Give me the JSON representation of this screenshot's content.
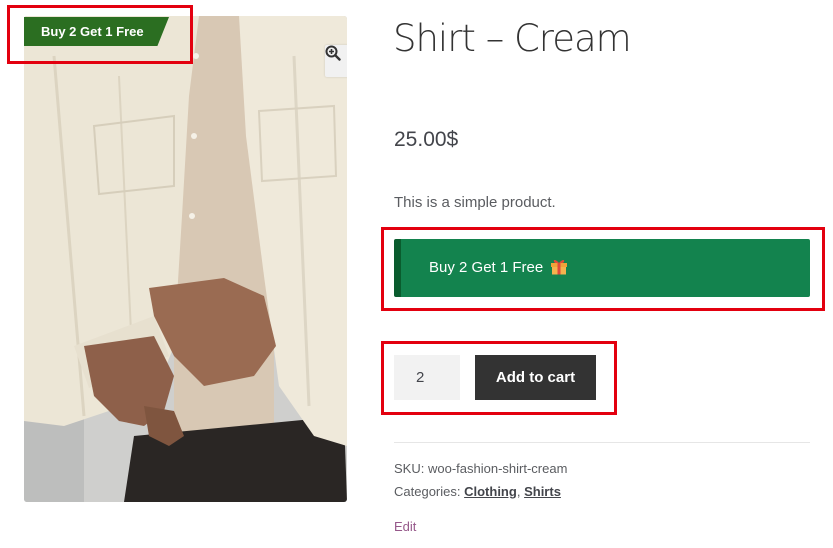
{
  "product": {
    "title": "Shirt – Cream",
    "price": "25.00$",
    "short_description": "This is a simple product.",
    "image_alt": "Man buttoning a cream corduroy shirt"
  },
  "badge": {
    "label": "Buy 2 Get 1 Free",
    "color": "#2b6e21"
  },
  "offer": {
    "label": "Buy 2 Get 1 Free",
    "icon": "gift-icon",
    "color": "#13834e"
  },
  "cart": {
    "quantity": "2",
    "add_label": "Add to cart"
  },
  "meta": {
    "sku_label": "SKU:",
    "sku_value": "woo-fashion-shirt-cream",
    "categories_label": "Categories:",
    "categories": [
      "Clothing",
      "Shirts"
    ],
    "category_separator": ","
  },
  "edit_label": "Edit",
  "icons": {
    "zoom": "zoom-in-icon"
  },
  "colors": {
    "annotation": "#e3000f",
    "button": "#333333",
    "link": "#96588a"
  }
}
